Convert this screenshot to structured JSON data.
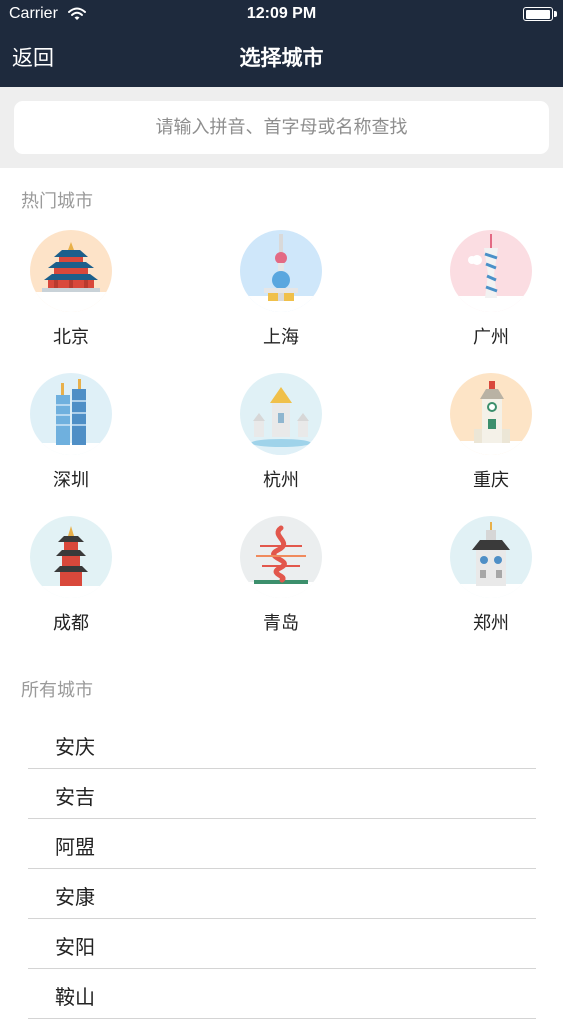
{
  "status_bar": {
    "carrier": "Carrier",
    "time": "12:09 PM",
    "battery_level": 1.0
  },
  "nav": {
    "back_label": "返回",
    "title": "选择城市"
  },
  "search": {
    "placeholder": "请输入拼音、首字母或名称查找",
    "value": ""
  },
  "hot_section": {
    "title": "热门城市",
    "cities": [
      {
        "name": "北京",
        "icon": "beijing-temple-icon",
        "bg": "#fde3c8"
      },
      {
        "name": "上海",
        "icon": "shanghai-tower-icon",
        "bg": "#cfe7fa"
      },
      {
        "name": "广州",
        "icon": "guangzhou-tower-icon",
        "bg": "#fbdde2"
      },
      {
        "name": "深圳",
        "icon": "shenzhen-skyscraper-icon",
        "bg": "#dff0f7"
      },
      {
        "name": "杭州",
        "icon": "hangzhou-pavilion-icon",
        "bg": "#e0f1f6"
      },
      {
        "name": "重庆",
        "icon": "chongqing-clocktower-icon",
        "bg": "#fde4c6"
      },
      {
        "name": "成都",
        "icon": "chengdu-pagoda-icon",
        "bg": "#e2f2f5"
      },
      {
        "name": "青岛",
        "icon": "qingdao-sculpture-icon",
        "bg": "#ebeeef"
      },
      {
        "name": "郑州",
        "icon": "zhengzhou-tower-icon",
        "bg": "#e1f1f5"
      }
    ]
  },
  "all_section": {
    "title": "所有城市",
    "cities": [
      "安庆",
      "安吉",
      "阿盟",
      "安康",
      "安阳",
      "鞍山"
    ]
  }
}
